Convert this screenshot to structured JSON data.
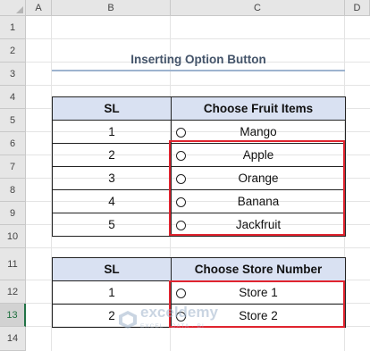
{
  "columns": [
    "A",
    "B",
    "C",
    "D"
  ],
  "rows": [
    "1",
    "2",
    "3",
    "4",
    "5",
    "6",
    "7",
    "8",
    "9",
    "10",
    "11",
    "12",
    "13",
    "14"
  ],
  "title": "Inserting Option Button",
  "table1": {
    "headers": [
      "SL",
      "Choose Fruit Items"
    ],
    "rows": [
      {
        "sl": "1",
        "item": "Mango"
      },
      {
        "sl": "2",
        "item": "Apple"
      },
      {
        "sl": "3",
        "item": "Orange"
      },
      {
        "sl": "4",
        "item": "Banana"
      },
      {
        "sl": "5",
        "item": "Jackfruit"
      }
    ]
  },
  "table2": {
    "headers": [
      "SL",
      "Choose Store Number"
    ],
    "rows": [
      {
        "sl": "1",
        "item": "Store 1"
      },
      {
        "sl": "2",
        "item": "Store 2"
      }
    ]
  },
  "watermark": {
    "brand": "exceldemy",
    "tagline": "EXCEL · DATA · BI"
  },
  "colors": {
    "header_fill": "#d9e1f2",
    "title": "#44546a",
    "highlight": "#e0242f",
    "active_row": "#217346"
  }
}
